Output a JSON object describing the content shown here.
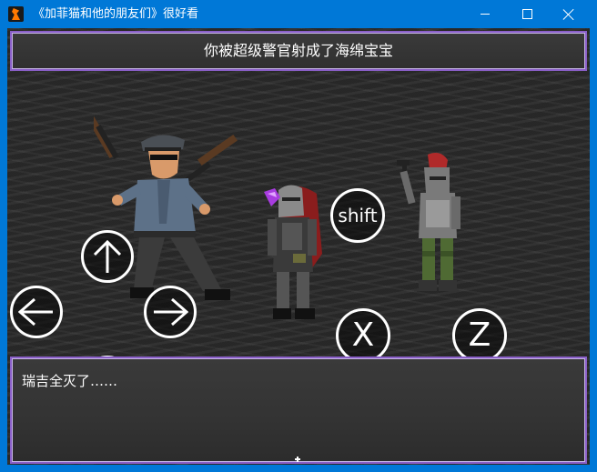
{
  "window": {
    "title": "《加菲猫和他的朋友们》很好看"
  },
  "game": {
    "message": "你被超级警官射成了海绵宝宝",
    "dialog_text": "瑞吉全灭了……"
  },
  "controls": {
    "up": "up-arrow-icon",
    "down": "down-arrow-icon",
    "left": "left-arrow-icon",
    "right": "right-arrow-icon",
    "shift_label": "shift",
    "x_label": "X",
    "z_label": "Z"
  },
  "colors": {
    "titlebar": "#0078d7",
    "frame_border": "#8a5fc8",
    "background": "#2d2d2d"
  }
}
